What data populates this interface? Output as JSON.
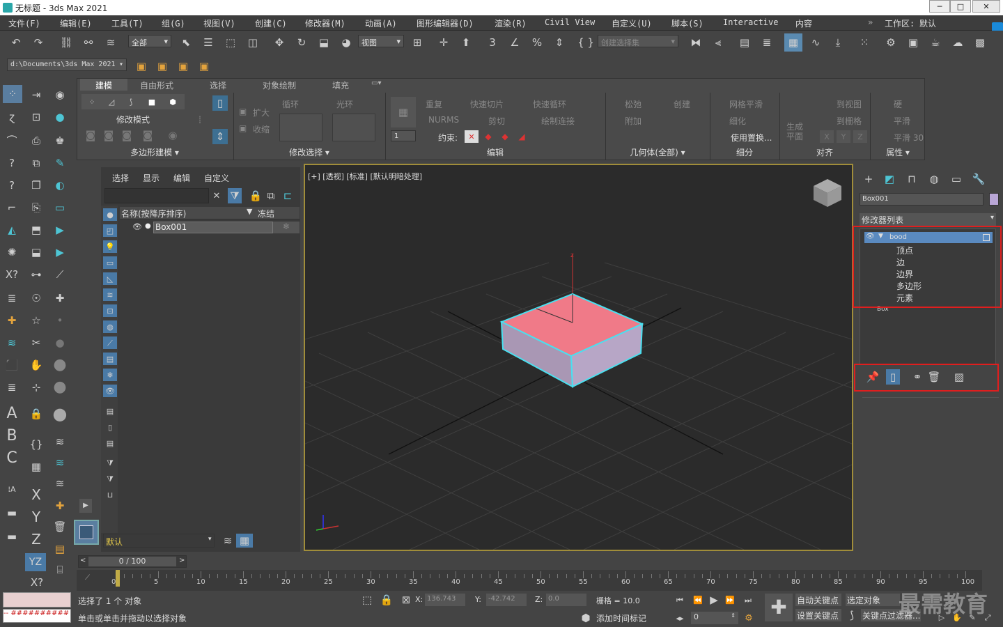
{
  "titlebar": {
    "title": "无标题 - 3ds Max 2021",
    "minimize": "─",
    "maximize": "□",
    "close": "✕"
  },
  "menu": [
    "文件(F)",
    "编辑(E)",
    "工具(T)",
    "组(G)",
    "视图(V)",
    "创建(C)",
    "修改器(M)",
    "动画(A)",
    "图形编辑器(D)",
    "渲染(R)",
    "Civil View",
    "自定义(U)",
    "脚本(S)",
    "Interactive",
    "内容"
  ],
  "workspace": {
    "label": "工作区:",
    "value": "默认"
  },
  "toolbar": {
    "filter_value": "全部",
    "refcoord_value": "视图",
    "selection_set_placeholder": "创建选择集"
  },
  "pathbar": {
    "path": "d:\\Documents\\3ds Max 2021"
  },
  "ribbon": {
    "tabs": [
      "建模",
      "自由形式",
      "选择",
      "对象绘制",
      "填充"
    ],
    "active_tab": "建模",
    "groups": {
      "poly": {
        "mode_label": "修改模式",
        "footer": "多边形建模 ▾"
      },
      "modsel": {
        "grow": "扩大",
        "shrink": "收缩",
        "loop": "循环",
        "ring": "光环",
        "footer": "修改选择 ▾"
      },
      "edit": {
        "repeat": "重复",
        "quickslice": "快速切片",
        "quickloop": "快速循环",
        "nurms": "NURMS",
        "cut": "剪切",
        "paintconnect": "绘制连接",
        "constraint": "约束:",
        "spinner": "1",
        "footer": "编辑"
      },
      "geom": {
        "relax": "松弛",
        "create": "创建",
        "attach": "附加",
        "footer": "几何体(全部) ▾"
      },
      "subdiv": {
        "meshsmooth": "网格平滑",
        "tessellate": "细化",
        "usedisp": "使用置换...",
        "footer": "细分"
      },
      "align": {
        "genplane": "生成\n平面",
        "toview": "到视图",
        "togrid": "到栅格",
        "x": "X",
        "y": "Y",
        "z": "Z",
        "footer": "对齐"
      },
      "props": {
        "hard": "硬",
        "smooth": "平滑",
        "smooth30": "平滑 30",
        "footer": "属性 ▾"
      }
    }
  },
  "scene": {
    "menu": [
      "选择",
      "显示",
      "编辑",
      "自定义"
    ],
    "col_name": "名称(按降序排序)",
    "col_freeze": "冻结",
    "rows": [
      {
        "name": "Box001",
        "freeze": "❄"
      }
    ],
    "layer": "默认"
  },
  "viewport": {
    "label": "[+] [透视] [标准] [默认明暗处理]"
  },
  "command_panel": {
    "object_name": "Box001",
    "modifier_list": "修改器列表",
    "stack_top": "bood",
    "subobjects": [
      "顶点",
      "边",
      "边界",
      "多边形",
      "元素"
    ],
    "base": "Box",
    "object_color": "#b9a6d6"
  },
  "timeline": {
    "frame_display": "0 / 100",
    "ticks": [
      "0",
      "5",
      "10",
      "15",
      "20",
      "25",
      "30",
      "35",
      "40",
      "45",
      "50",
      "55",
      "60",
      "65",
      "70",
      "75",
      "80",
      "85",
      "90",
      "95",
      "100"
    ]
  },
  "status": {
    "selected": "选择了 1 个 对象",
    "prompt": "单击或单击并拖动以选择对象",
    "x_label": "X:",
    "x_value": "136.743",
    "y_label": "Y:",
    "y_value": "-42.742",
    "z_label": "Z:",
    "z_value": "0.0",
    "grid": "栅格 = 10.0",
    "add_time_tag": "添加时间标记",
    "autokey": "自动关键点",
    "setkey": "设置关键点",
    "selected_obj": "选定对象",
    "key_filters": "关键点过滤器...",
    "frame": "0",
    "watermark": "最需教育"
  }
}
